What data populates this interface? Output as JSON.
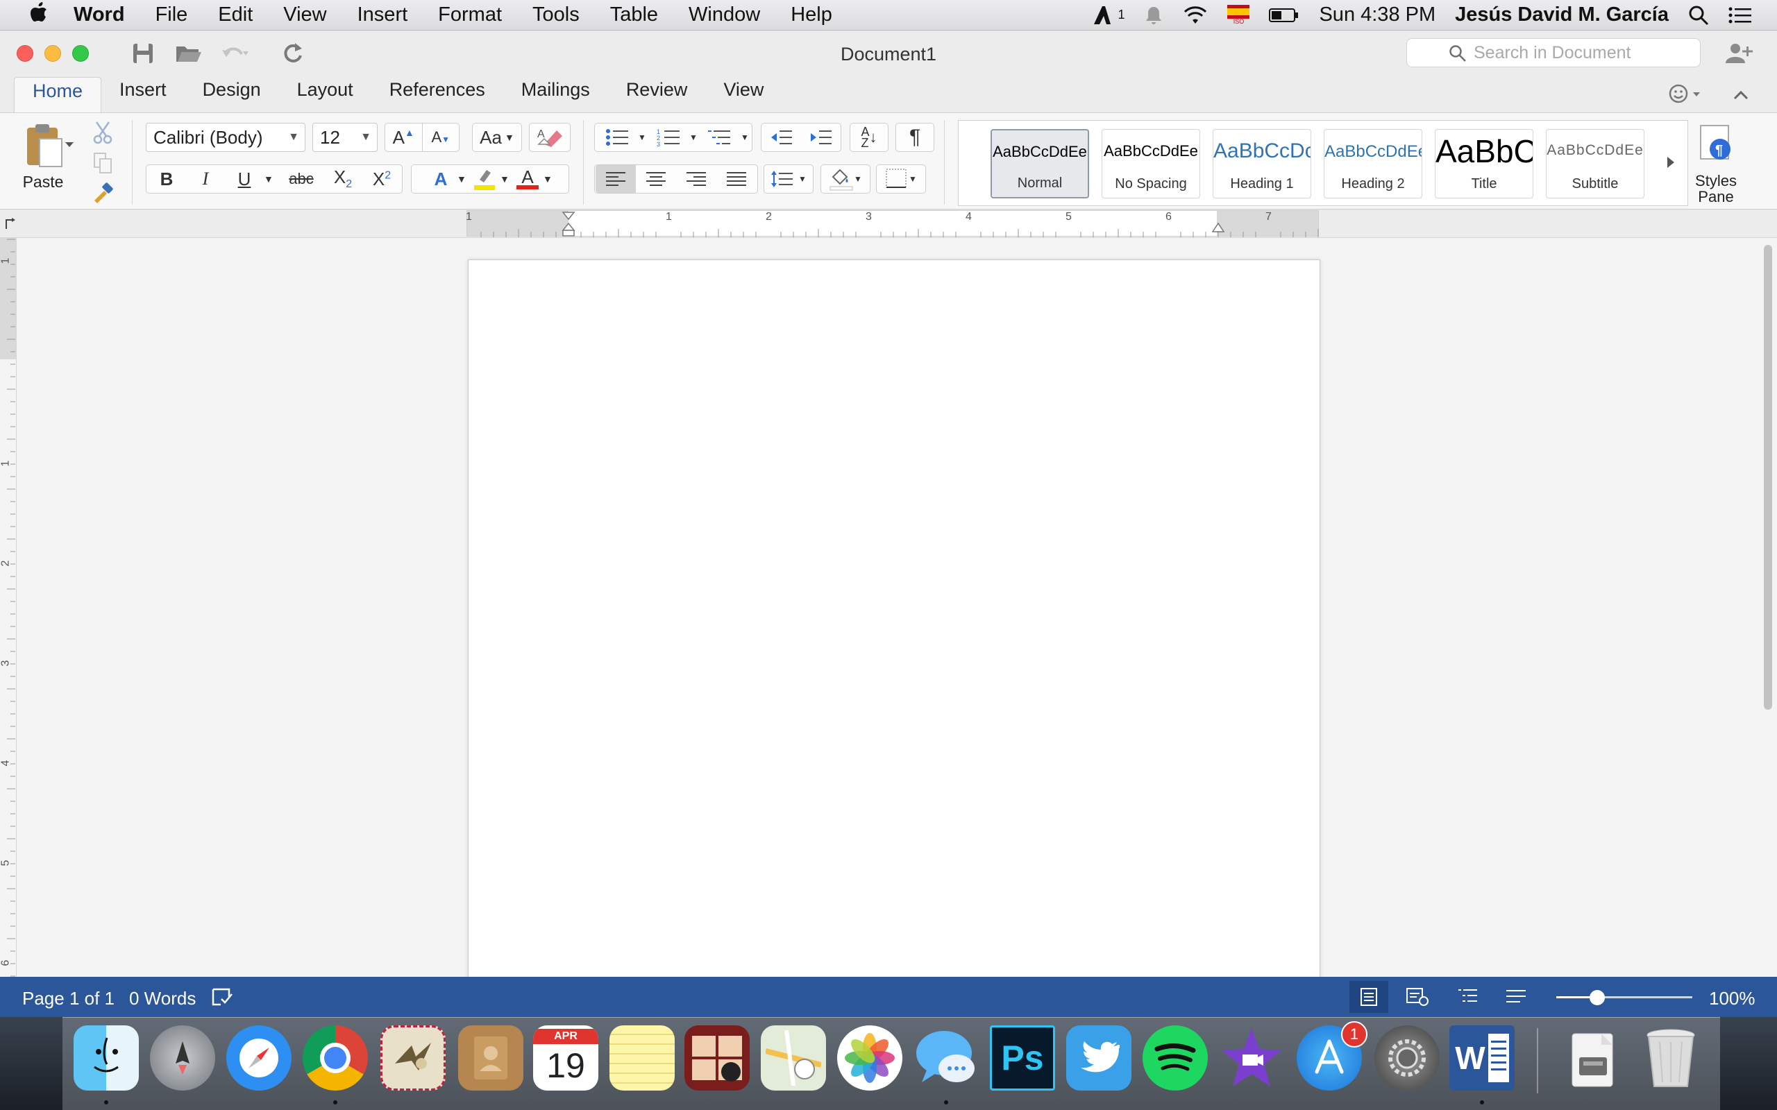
{
  "menubar": {
    "app_name": "Word",
    "items": [
      "File",
      "Edit",
      "View",
      "Insert",
      "Format",
      "Tools",
      "Table",
      "Window",
      "Help"
    ],
    "clock": "Sun 4:38 PM",
    "user": "Jesús David M. García",
    "adobe_badge": "1",
    "flag_label": "ISO",
    "tray_icons": [
      "adobe-icon",
      "notification-bell-icon",
      "wifi-icon",
      "spain-flag-icon",
      "battery-icon",
      "spotlight-search-icon",
      "notification-center-icon"
    ]
  },
  "window": {
    "title": "Document1",
    "search_placeholder": "Search in Document",
    "quick_access": [
      "save-icon",
      "open-folder-icon",
      "undo-icon",
      "redo-icon"
    ]
  },
  "ribbon": {
    "tabs": [
      "Home",
      "Insert",
      "Design",
      "Layout",
      "References",
      "Mailings",
      "Review",
      "View"
    ],
    "active_tab": "Home",
    "paste_label": "Paste",
    "font_name": "Calibri (Body)",
    "font_size": "12",
    "styles": [
      {
        "sample": "AaBbCcDdEe",
        "name": "Normal"
      },
      {
        "sample": "AaBbCcDdEe",
        "name": "No Spacing"
      },
      {
        "sample": "AaBbCcDc",
        "name": "Heading 1"
      },
      {
        "sample": "AaBbCcDdEe",
        "name": "Heading 2"
      },
      {
        "sample": "AaBbC",
        "name": "Title"
      },
      {
        "sample": "AaBbCcDdEe",
        "name": "Subtitle"
      }
    ],
    "selected_style": "Normal",
    "styles_pane_label": [
      "Styles",
      "Pane"
    ],
    "format_labels": {
      "bold": "B",
      "italic": "I",
      "underline": "U",
      "strikethrough": "abc",
      "subscript": "X",
      "sub_mark": "2",
      "superscript": "X",
      "sup_mark": "2",
      "grow_font": "A",
      "shrink_font": "A",
      "font_color": "A",
      "text_effects": "A",
      "change_case": "Aa",
      "sort": "A",
      "sort_b": "Z",
      "pilcrow": "¶"
    },
    "accent_colors": {
      "highlight": "#f5e400",
      "font_color": "#e0241b",
      "text_effects": "#2e6dd8"
    }
  },
  "rulers": {
    "horizontal": [
      "1",
      "1",
      "2",
      "3",
      "4",
      "5",
      "6",
      "7"
    ],
    "vertical": [
      "1",
      "1",
      "2",
      "3",
      "4",
      "5",
      "6"
    ]
  },
  "status": {
    "page": "Page 1 of 1",
    "words": "0 Words",
    "zoom": "100%",
    "zoom_fraction": 0.3
  },
  "dock": {
    "apps": [
      "Finder",
      "Launchpad",
      "Safari",
      "Chrome",
      "Mail",
      "Contacts",
      "Calendar",
      "Notes",
      "Photo Booth",
      "Maps",
      "Photos",
      "Messages",
      "Photoshop",
      "Twitter",
      "Spotify",
      "iMovie",
      "App Store",
      "System Preferences",
      "Word",
      "Downloads",
      "Trash"
    ],
    "calendar_month": "APR",
    "calendar_day": "19",
    "photoshop_label": "Ps",
    "word_label": "W",
    "app_store_badge": "1"
  },
  "colors": {
    "accent": "#2b579a",
    "tab_active_text": "#2b579a"
  }
}
